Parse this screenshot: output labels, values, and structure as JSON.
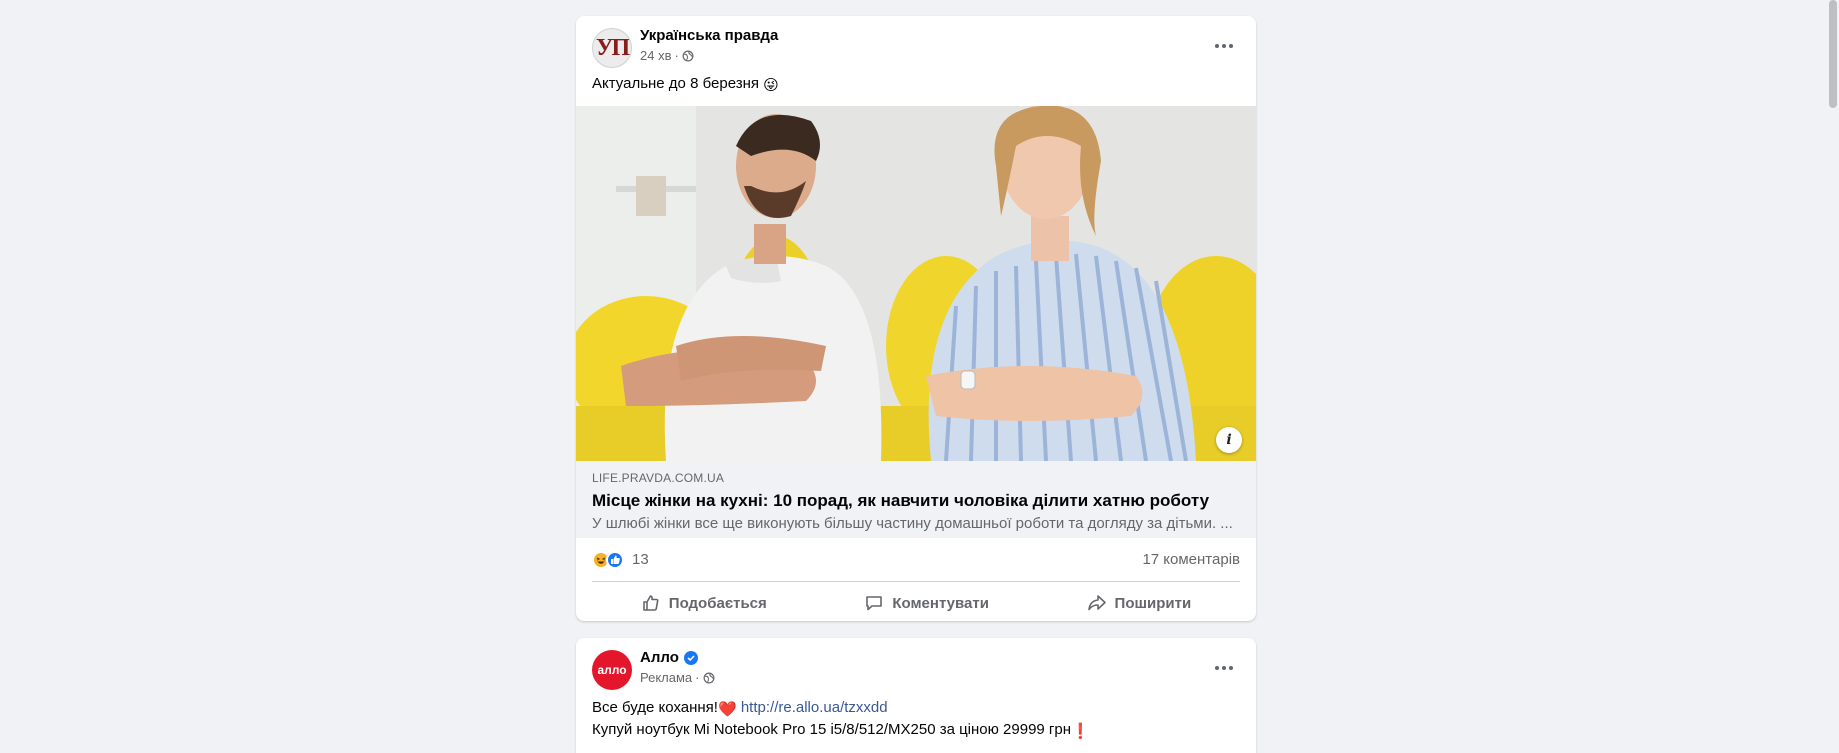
{
  "feed": {
    "posts": [
      {
        "author": "Українська правда",
        "avatar_text": "УП",
        "avatar_icon": "ukrainska-pravda-logo",
        "time": "24 хв",
        "separator": "·",
        "audience_icon": "globe-icon",
        "text": "Актуальне до 8 березня",
        "text_emoji": "😜",
        "link": {
          "domain": "LIFE.PRAVDA.COM.UA",
          "title": "Місце жінки на кухні: 10 порад, як навчити чоловіка ділити хатню роботу",
          "description": "У шлюбі жінки все ще виконують більшу частину домашньої роботи та догляду за дітьми. ...",
          "info_label": "i"
        },
        "reactions": {
          "icons": [
            "haha-reaction-icon",
            "like-reaction-icon"
          ],
          "count": "13",
          "comments": "17 коментарів"
        },
        "actions": {
          "like": "Подобається",
          "comment": "Коментувати",
          "share": "Поширити"
        }
      },
      {
        "author": "Алло",
        "avatar_text": "алло",
        "verified": true,
        "sponsored": "Реклама",
        "separator": "·",
        "audience_icon": "globe-icon",
        "text_line1": "Все буде кохання!",
        "text_line1_emoji": "❤️",
        "link_url": "http://re.allo.ua/tzxxdd",
        "text_line2": "Купуй ноутбук Mi Notebook Pro 15 i5/8/512/MX250 за ціною 29999 грн",
        "text_line2_emoji": "❗"
      }
    ]
  },
  "colors": {
    "background": "#f0f2f5",
    "card": "#ffffff",
    "secondary_text": "#65676b",
    "accent_blue": "#1877f2",
    "link_blue": "#385898",
    "allo_red": "#e3162b"
  }
}
